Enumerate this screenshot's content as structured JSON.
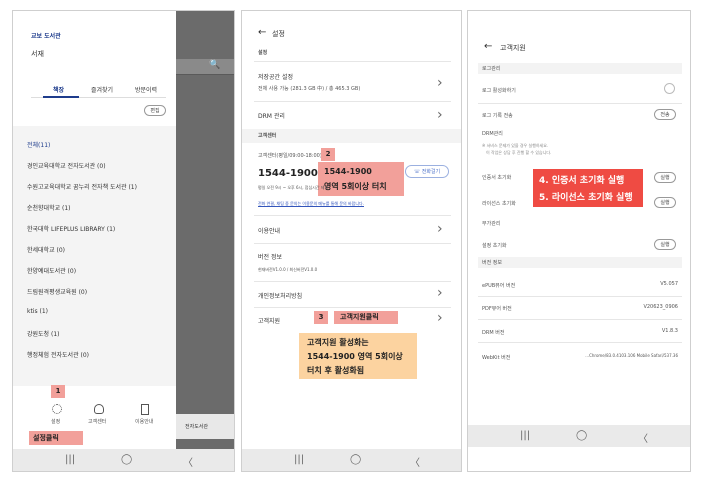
{
  "p1": {
    "title": "교보 도서관",
    "subtitle": "서재",
    "tabs": [
      "책장",
      "즐겨찾기",
      "방문이력"
    ],
    "edit_label": "편집",
    "list": [
      "전체(11)",
      "경인교육대학교 전자도서관 (0)",
      "수원고교육대학교 꿈누리 전자책 도서관 (1)",
      "순천향대학교 (1)",
      "한국대학 LIFEPLUS LIBRARY (1)",
      "한세대학교 (0)",
      "한양예대도서관 (0)",
      "드림원격평생교육원 (0)",
      "ktis (1)",
      "강원도청 (1)",
      "행정체험 전자도서관 (0)"
    ],
    "search_icon": "🔍",
    "bottom_nav": [
      "설정",
      "고객센터",
      "이용안내"
    ],
    "step_num": "1",
    "step_label": "설정클릭",
    "overlay_label": "전자도서관"
  },
  "p2": {
    "back": "←",
    "title": "설정",
    "section1": "설정",
    "storage_title": "저장공간 설정",
    "storage_desc": "전체 사용 가능 (281.3 GB 中) / 총 465.3 GB)",
    "drm_title": "DRM 관리",
    "section2": "고객센터",
    "cs_label": "고객센터(평일/09:00-18:00)",
    "phone": "1544-1900",
    "call_button": "전화걸기",
    "cs_desc": "평일 오전 9시 ~ 오후 6시, 점심시간 제외",
    "cs_link": "전화 연결, 채팅 중 문의는 이용문의 메뉴를 통해 문의 바랍니다.",
    "usage_title": "이용안내",
    "version_title": "버전 정보",
    "version_desc": "현재버전V1.0.0 / 최신버전V1.0.0",
    "privacy_title": "개인정보처리방침",
    "support_title": "고객지원",
    "step2_num": "2",
    "step2_text_1": "1544-1900",
    "step2_text_2": "영역 5회이상 터치",
    "step3_num": "3",
    "step3_text": "고객지원클릭",
    "note_1": "고객지원 활성화는",
    "note_2": "1544-1900 영역 5회이상",
    "note_3": "터치 후 활성화됨"
  },
  "p3": {
    "back": "←",
    "title": "고객지원",
    "log_section": "로그관리",
    "log_enable": "로그 활성화하기",
    "log_send": "로그 기록 전송",
    "send_btn": "전송",
    "drm_section": "DRM관리",
    "drm_note_1": "※ 서비스 문제가 있을 경우 실행하세요.",
    "drm_note_2": "이 작업은 상담 후 진행 할 수 있습니다.",
    "cert_reset": "인증서 초기화",
    "license_reset": "라이선스 초기화",
    "run_btn": "실행",
    "misc_section": "부가관리",
    "settings_reset": "설정 초기화",
    "version_section": "버전 정보",
    "epub_label": "ePUB뷰어 버전",
    "epub_value": "V5.057",
    "pdf_label": "PDF뷰어 버전",
    "pdf_value": "V20623_0906",
    "drm_label": "DRM 버전",
    "drm_value": "V1.8.3",
    "webkit_label": "WebKit 버전",
    "webkit_value": "...Chrome/83.0.4103.106 Mobile Safari/537.36",
    "step45_line1": "4. 인증서 초기화 실행",
    "step45_line2": "5. 라이선스 초기화 실행"
  },
  "nav": {
    "recent": "|||",
    "home": "◯",
    "back": "〈"
  },
  "colors": {
    "red": "#ef4b43",
    "pink": "#f2a09a",
    "orange": "#fcd3a0",
    "blue": "#1e3c8c"
  }
}
